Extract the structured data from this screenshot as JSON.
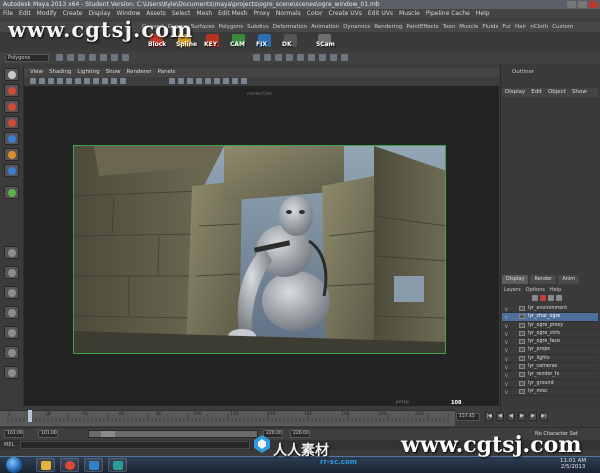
{
  "window": {
    "title": "Autodesk Maya 2013 x64 - Student Version: C:\\Users\\Kyle\\Documents\\maya\\projects\\ogre_scene\\scenes\\ogre_window_01.mb"
  },
  "menubar": [
    "File",
    "Edit",
    "Modify",
    "Create",
    "Display",
    "Window",
    "Assets",
    "Select",
    "Mesh",
    "Edit Mesh",
    "Proxy",
    "Normals",
    "Color",
    "Create UVs",
    "Edit UVs",
    "Muscle",
    "Pipeline Cache",
    "Help"
  ],
  "watermark": {
    "top": "www.cgtsj.com",
    "bottom": "www.cgtsj.com",
    "cn": "人人素材",
    "url": "rr-sc.com"
  },
  "shelf": {
    "tabs": [
      "General",
      "Curves",
      "Surfaces",
      "Polygons",
      "Subdivs",
      "Deformation",
      "Animation",
      "Dynamics",
      "Rendering",
      "PaintEffects",
      "Toon",
      "Muscle",
      "Fluids",
      "Fur",
      "Hair",
      "nCloth",
      "Custom"
    ],
    "buttons": [
      {
        "label": "Block",
        "icon": "block-icon",
        "color": "#c23b2e"
      },
      {
        "label": "Spline",
        "icon": "spline-icon",
        "color": "#d8a326"
      },
      {
        "label": "KEY",
        "icon": "key-icon",
        "color": "#b7331f"
      },
      {
        "label": "CAM",
        "icon": "camera-icon",
        "color": "#3a8a3c"
      },
      {
        "label": "FIX",
        "icon": "fix-icon",
        "color": "#2b6fb1"
      },
      {
        "label": "DK",
        "icon": "dk-icon",
        "color": "#555555"
      },
      {
        "label": "5Cam",
        "icon": "camera-rig-icon",
        "color": "#6e6e6e"
      }
    ]
  },
  "status_line": {
    "mode": "Polygons"
  },
  "panel": {
    "menu": [
      "View",
      "Shading",
      "Lighting",
      "Show",
      "Renderer",
      "Panels"
    ],
    "camera_label": "renderCam",
    "frame_label": "persp",
    "frame_count": "108"
  },
  "right_panel": {
    "title": "Outliner",
    "menu": [
      "Display",
      "Edit",
      "Object",
      "Show"
    ],
    "layer_tabs": [
      "Display",
      "Render",
      "Anim"
    ],
    "layer_submenu": [
      "Layers",
      "Options",
      "Help"
    ],
    "layers": [
      {
        "name": "lyr_environment",
        "visible": "V",
        "selected": false
      },
      {
        "name": "lyr_char_ogre",
        "visible": "V",
        "selected": true
      },
      {
        "name": "lyr_ogre_proxy",
        "visible": "V",
        "selected": false
      },
      {
        "name": "lyr_ogre_ctrls",
        "visible": "V",
        "selected": false
      },
      {
        "name": "lyr_ogre_face",
        "visible": "V",
        "selected": false
      },
      {
        "name": "lyr_props",
        "visible": "V",
        "selected": false
      },
      {
        "name": "lyr_lights",
        "visible": "V",
        "selected": false
      },
      {
        "name": "lyr_cameras",
        "visible": "V",
        "selected": false
      },
      {
        "name": "lyr_render_fx",
        "visible": "V",
        "selected": false
      },
      {
        "name": "lyr_ground",
        "visible": "V",
        "selected": false
      },
      {
        "name": "lyr_misc",
        "visible": "V",
        "selected": false
      }
    ]
  },
  "timeline": {
    "current_time": "157.45",
    "current_frame_fraction": 0.05,
    "ticks": [
      "1",
      "20",
      "40",
      "60",
      "80",
      "100",
      "120",
      "140",
      "160",
      "180",
      "200",
      "220"
    ],
    "range_start": "101.00",
    "range_inner_start": "101.00",
    "range_inner_end": "220.00",
    "range_end": "220.00",
    "character_set": "No Character Set"
  },
  "command_line": {
    "label": "MEL"
  },
  "taskbar": {
    "time": "11:01 AM",
    "date": "2/5/2013"
  },
  "colors": {
    "accent": "#4c6f9c",
    "render_region_border": "#3fa34d",
    "watermark_blue": "#2f9be0"
  }
}
